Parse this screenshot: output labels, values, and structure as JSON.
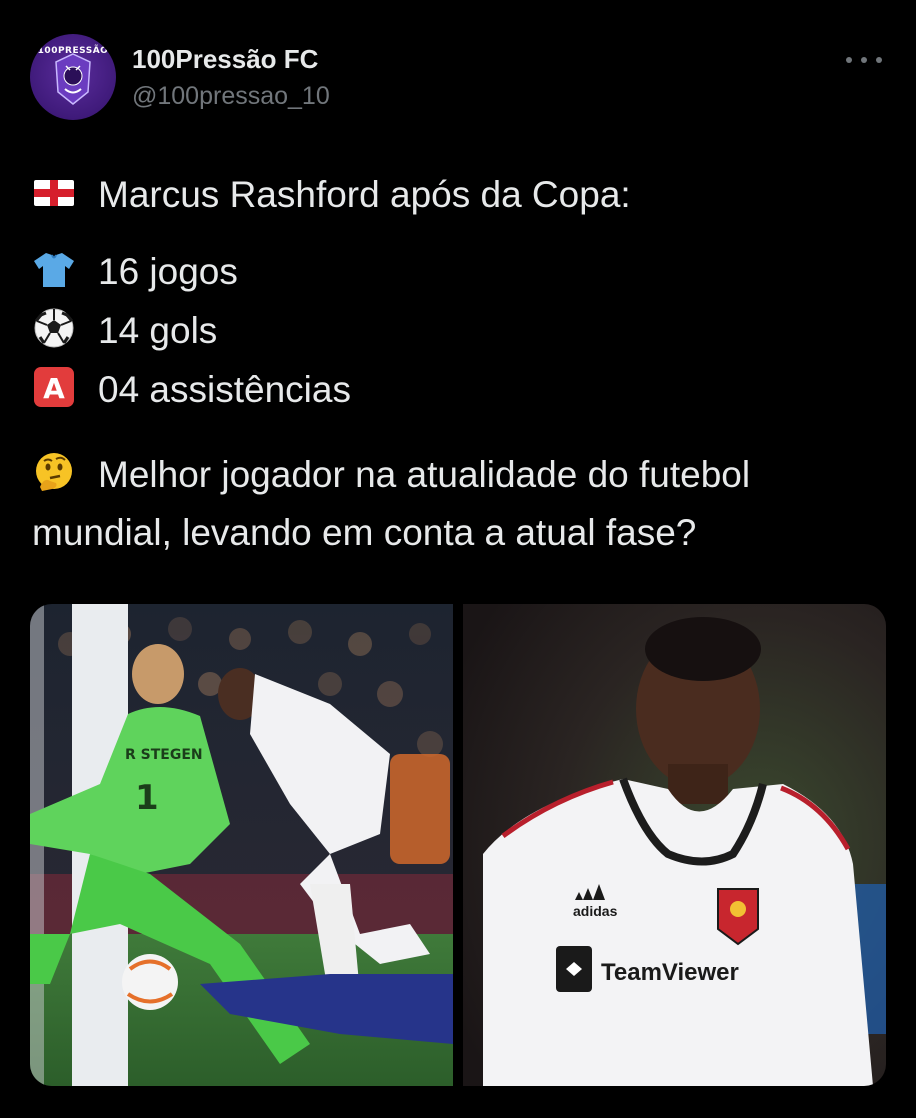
{
  "author": {
    "name": "100Pressão FC",
    "handle": "@100pressao_10",
    "avatar_text": "100PRESSÃO"
  },
  "tweet": {
    "headline": "Marcus Rashford após da Copa:",
    "stats": [
      {
        "icon": "jersey-icon",
        "text": "16 jogos"
      },
      {
        "icon": "soccer-ball-icon",
        "text": "14 gols"
      },
      {
        "icon": "letter-a-icon",
        "text": "04 assistências"
      }
    ],
    "question": "Melhor jogador na atualidade do futebol mundial, levando em conta a atual fase?"
  },
  "media": {
    "left_photo": {
      "jersey_name": "R STEGEN",
      "jersey_number": "1"
    },
    "right_photo": {
      "sponsor": "TeamViewer",
      "brand": "adidas"
    }
  },
  "colors": {
    "background": "#000000",
    "text": "#e7e9ea",
    "secondary": "#71767b",
    "avatar": "#3f1a7a"
  }
}
